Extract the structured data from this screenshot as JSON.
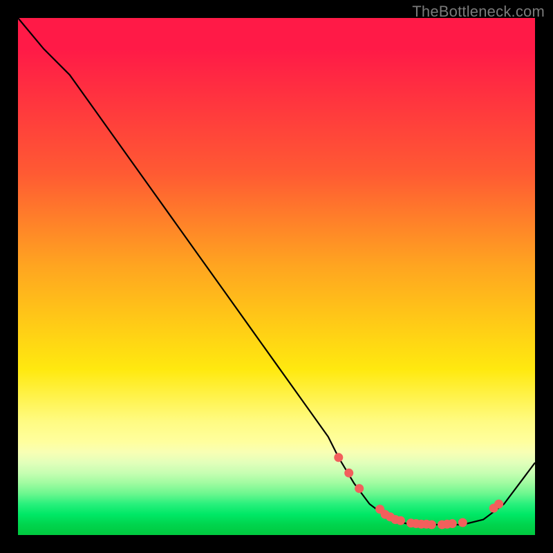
{
  "watermark": "TheBottleneck.com",
  "chart_data": {
    "type": "line",
    "title": "",
    "xlabel": "",
    "ylabel": "",
    "xlim": [
      0,
      100
    ],
    "ylim": [
      0,
      100
    ],
    "series": [
      {
        "name": "curve",
        "x": [
          0,
          5,
          10,
          15,
          20,
          25,
          30,
          35,
          40,
          45,
          50,
          55,
          60,
          62,
          65,
          68,
          72,
          76,
          80,
          83,
          86,
          90,
          94,
          97,
          100
        ],
        "y": [
          100,
          94,
          89,
          82,
          75,
          68,
          61,
          54,
          47,
          40,
          33,
          26,
          19,
          15,
          10,
          6,
          3,
          2,
          2,
          2,
          2,
          3,
          6,
          10,
          14
        ]
      }
    ],
    "markers": {
      "name": "highlight-dots",
      "x": [
        62,
        64,
        66,
        70,
        71,
        72,
        73,
        74,
        76,
        77,
        78,
        79,
        80,
        82,
        83,
        84,
        86,
        92,
        93
      ],
      "y": [
        15,
        12,
        9,
        5,
        4,
        3.5,
        3,
        2.8,
        2.3,
        2.2,
        2.1,
        2.1,
        2.0,
        2.0,
        2.1,
        2.2,
        2.4,
        5.2,
        6.0
      ]
    },
    "background_gradient": {
      "direction": "vertical",
      "stops": [
        {
          "pos": 0.0,
          "color": "#ff1a47"
        },
        {
          "pos": 0.3,
          "color": "#ff5a33"
        },
        {
          "pos": 0.48,
          "color": "#ffa520"
        },
        {
          "pos": 0.68,
          "color": "#ffe90f"
        },
        {
          "pos": 0.82,
          "color": "#ffff9e"
        },
        {
          "pos": 0.9,
          "color": "#9ffba0"
        },
        {
          "pos": 0.96,
          "color": "#00e866"
        },
        {
          "pos": 1.0,
          "color": "#00c93f"
        }
      ]
    }
  }
}
